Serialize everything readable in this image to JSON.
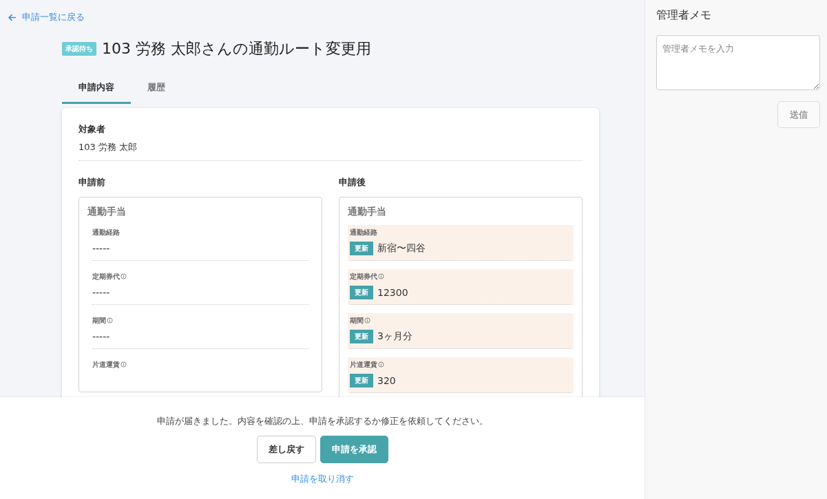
{
  "back_link": {
    "label": "申請一覧に戻る"
  },
  "status_badge": "承認待ち",
  "title": "103 労務 太郎さんの通勤ルート変更用",
  "tabs": [
    {
      "label": "申請内容",
      "selected": true
    },
    {
      "label": "履歴",
      "selected": false
    }
  ],
  "subject": {
    "label": "対象者",
    "value": "103 労務 太郎"
  },
  "columns": [
    {
      "heading": "申請前",
      "section": "通勤手当",
      "fields": [
        {
          "label": "通勤経路",
          "info": false,
          "value": "-----",
          "updated": false
        },
        {
          "label": "定期券代",
          "info": true,
          "value": "-----",
          "updated": false
        },
        {
          "label": "期間",
          "info": true,
          "value": "-----",
          "updated": false
        },
        {
          "label": "片道運賃",
          "info": true,
          "updated": false
        }
      ]
    },
    {
      "heading": "申請後",
      "section": "通勤手当",
      "fields": [
        {
          "label": "通勤経路",
          "info": false,
          "value": "新宿〜四谷",
          "updated": true,
          "badge": "更新"
        },
        {
          "label": "定期券代",
          "info": true,
          "value": "12300",
          "updated": true,
          "badge": "更新"
        },
        {
          "label": "期間",
          "info": true,
          "value": "3ヶ月分",
          "updated": true,
          "badge": "更新"
        },
        {
          "label": "片道運賃",
          "info": true,
          "value": "320",
          "updated": true,
          "badge": "更新"
        }
      ]
    }
  ],
  "footer": {
    "message": "申請が届きました。内容を確認の上、申請を承認するか修正を依頼してください。",
    "buttons": [
      {
        "label": "差し戻す",
        "kind": "secondary"
      },
      {
        "label": "申請を承認",
        "kind": "primary"
      }
    ],
    "cancel_link": "申請を取り消す"
  },
  "memo": {
    "title": "管理者メモ",
    "placeholder": "管理者メモを入力",
    "submit": {
      "label": "送信",
      "disabled": true
    }
  }
}
